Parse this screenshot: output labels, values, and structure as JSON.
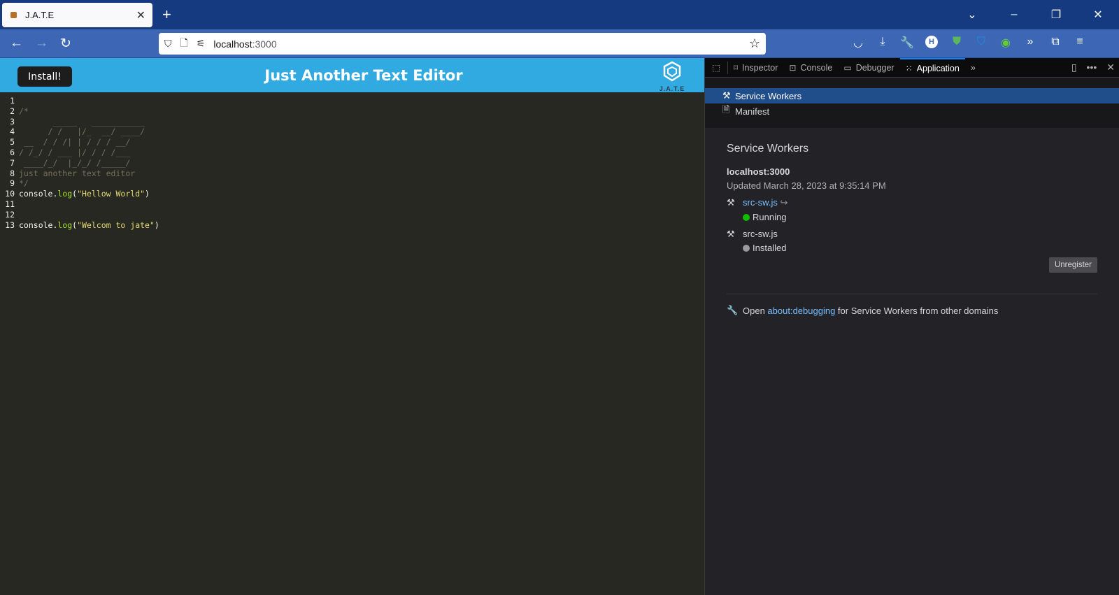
{
  "browser": {
    "tab_title": "J.A.T.E",
    "url_host": "localhost",
    "url_port": ":3000"
  },
  "app": {
    "install_label": "Install!",
    "title": "Just Another Text Editor",
    "logo_caption": "J.A.T.E"
  },
  "editor": {
    "lines": [
      {
        "n": "1",
        "parts": []
      },
      {
        "n": "2",
        "parts": [
          {
            "c": "cm",
            "t": "/*"
          }
        ]
      },
      {
        "n": "3",
        "parts": [
          {
            "c": "ascii",
            "t": "       _____   ___________"
          }
        ]
      },
      {
        "n": "4",
        "parts": [
          {
            "c": "ascii",
            "t": "      / /   |/_  __/ ____/"
          }
        ]
      },
      {
        "n": "5",
        "parts": [
          {
            "c": "ascii",
            "t": " __  / / /| | / / / __/"
          }
        ]
      },
      {
        "n": "6",
        "parts": [
          {
            "c": "ascii",
            "t": "/ /_/ / ___ |/ / / /___"
          }
        ]
      },
      {
        "n": "7",
        "parts": [
          {
            "c": "ascii",
            "t": " ____/_/  |_/_/ /_____/"
          }
        ]
      },
      {
        "n": "8",
        "parts": [
          {
            "c": "cm",
            "t": "just another text editor"
          }
        ]
      },
      {
        "n": "9",
        "parts": [
          {
            "c": "cm",
            "t": "*/"
          }
        ]
      },
      {
        "n": "10",
        "parts": [
          {
            "c": "plain",
            "t": "console."
          },
          {
            "c": "fn",
            "t": "log"
          },
          {
            "c": "plain",
            "t": "("
          },
          {
            "c": "str",
            "t": "\"Hellow World\""
          },
          {
            "c": "plain",
            "t": ")"
          }
        ]
      },
      {
        "n": "11",
        "parts": []
      },
      {
        "n": "12",
        "parts": []
      },
      {
        "n": "13",
        "parts": [
          {
            "c": "plain",
            "t": "console."
          },
          {
            "c": "fn",
            "t": "log"
          },
          {
            "c": "plain",
            "t": "("
          },
          {
            "c": "str",
            "t": "\"Welcom to jate\""
          },
          {
            "c": "plain",
            "t": ")"
          }
        ]
      }
    ]
  },
  "devtools": {
    "tabs": [
      {
        "label": "Inspector",
        "icon": "inspector-icon"
      },
      {
        "label": "Console",
        "icon": "console-icon"
      },
      {
        "label": "Debugger",
        "icon": "debugger-icon"
      },
      {
        "label": "Application",
        "icon": "application-icon"
      }
    ],
    "sidebar": [
      {
        "label": "Service Workers",
        "icon": "hammer-pick-icon"
      },
      {
        "label": "Manifest",
        "icon": "file-icon"
      }
    ],
    "heading": "Service Workers",
    "host": "localhost:3000",
    "updated": "Updated March 28, 2023 at 9:35:14 PM",
    "workers": [
      {
        "file": "src-sw.js",
        "status": "Running",
        "color": "#12bc00"
      },
      {
        "file": "src-sw.js",
        "status": "Installed",
        "color": "#9a9a9e"
      }
    ],
    "unregister_label": "Unregister",
    "footer_pre": "Open ",
    "footer_link": "about:debugging",
    "footer_post": " for Service Workers from other domains"
  }
}
